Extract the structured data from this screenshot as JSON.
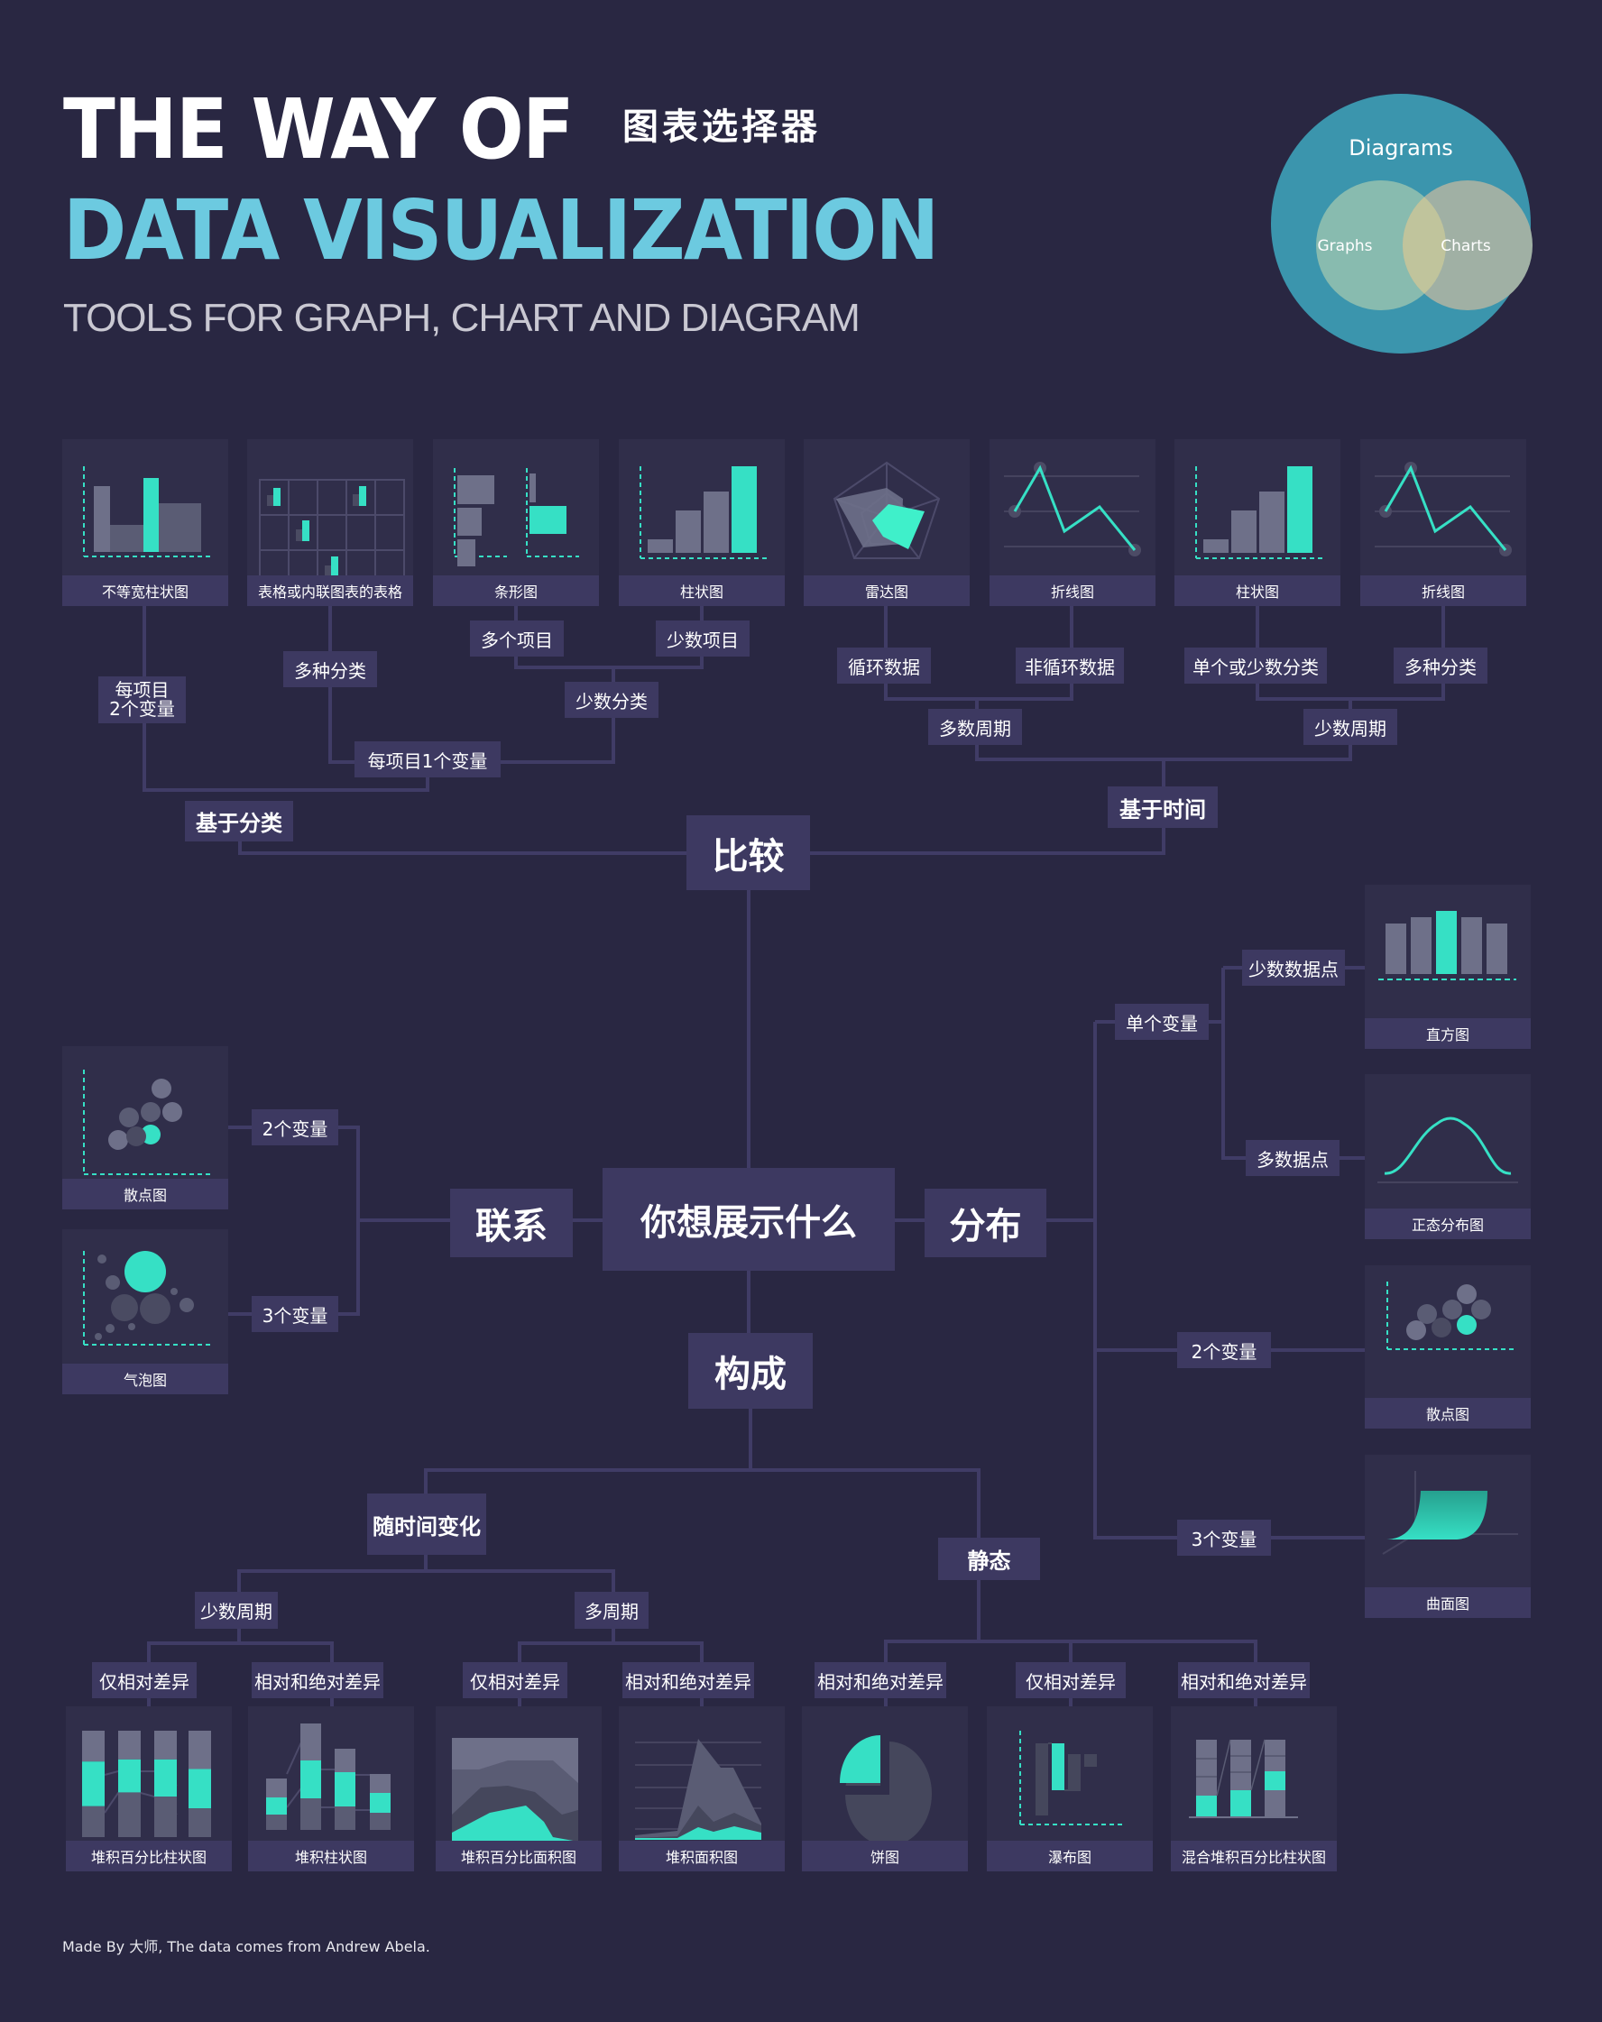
{
  "header": {
    "title_line1": "THE WAY OF",
    "title_line2": "DATA VISUALIZATION",
    "title_cn": "图表选择器",
    "subtitle": "TOOLS FOR GRAPH, CHART AND DIAGRAM"
  },
  "venn": {
    "outer_label": "Diagrams",
    "left_label": "Graphs",
    "right_label": "Charts",
    "colors": {
      "outer": "#3b95ad",
      "left": "#88bbaf",
      "right": "#a0b0a4",
      "overlap": "#c0c49c"
    }
  },
  "colors": {
    "background": "#292742",
    "node": "#3d3961",
    "card": "#302e4a",
    "accent": "#36e0c5",
    "bar_gray": "#6e7089",
    "bar_dark": "#4a4b62",
    "title_blue": "#6ccae0",
    "line": "#403c66"
  },
  "root": {
    "label": "你想展示什么"
  },
  "categories": {
    "comparison": "比较",
    "relationship": "联系",
    "distribution": "分布",
    "composition": "构成"
  },
  "comparison": {
    "by_category": "基于分类",
    "by_time": "基于时间",
    "two_vars_per_item": "每项目\n2个变量",
    "one_var_per_item": "每项目1个变量",
    "many_categories": "多种分类",
    "few_categories": "少数分类",
    "many_items": "多个项目",
    "few_items": "少数项目",
    "many_periods": "多数周期",
    "few_periods": "少数周期",
    "cyclical": "循环数据",
    "non_cyclical": "非循环数据",
    "single_or_few_categories": "单个或少数分类",
    "many_categories_time": "多种分类",
    "cards": [
      "不等宽柱状图",
      "表格或内联图表的表格",
      "条形图",
      "柱状图",
      "雷达图",
      "折线图",
      "柱状图",
      "折线图"
    ]
  },
  "relationship": {
    "two_vars": "2个变量",
    "three_vars": "3个变量",
    "cards": [
      "散点图",
      "气泡图"
    ]
  },
  "distribution": {
    "single_var": "单个变量",
    "few_points": "少数数据点",
    "many_points": "多数据点",
    "two_vars": "2个变量",
    "three_vars": "3个变量",
    "cards": [
      "直方图",
      "正态分布图",
      "散点图",
      "曲面图"
    ]
  },
  "composition": {
    "over_time": "随时间变化",
    "static": "静态",
    "few_periods": "少数周期",
    "many_periods": "多周期",
    "relative_only_1": "仅相对差异",
    "rel_abs_1": "相对和绝对差异",
    "relative_only_2": "仅相对差异",
    "rel_abs_2": "相对和绝对差异",
    "rel_abs_3": "相对和绝对差异",
    "relative_only_3": "仅相对差异",
    "rel_abs_4": "相对和绝对差异",
    "cards": [
      "堆积百分比柱状图",
      "堆积柱状图",
      "堆积百分比面积图",
      "堆积面积图",
      "饼图",
      "瀑布图",
      "混合堆积百分比柱状图"
    ]
  },
  "footer": {
    "credit": "Made By 大师, The data comes from Andrew Abela."
  }
}
